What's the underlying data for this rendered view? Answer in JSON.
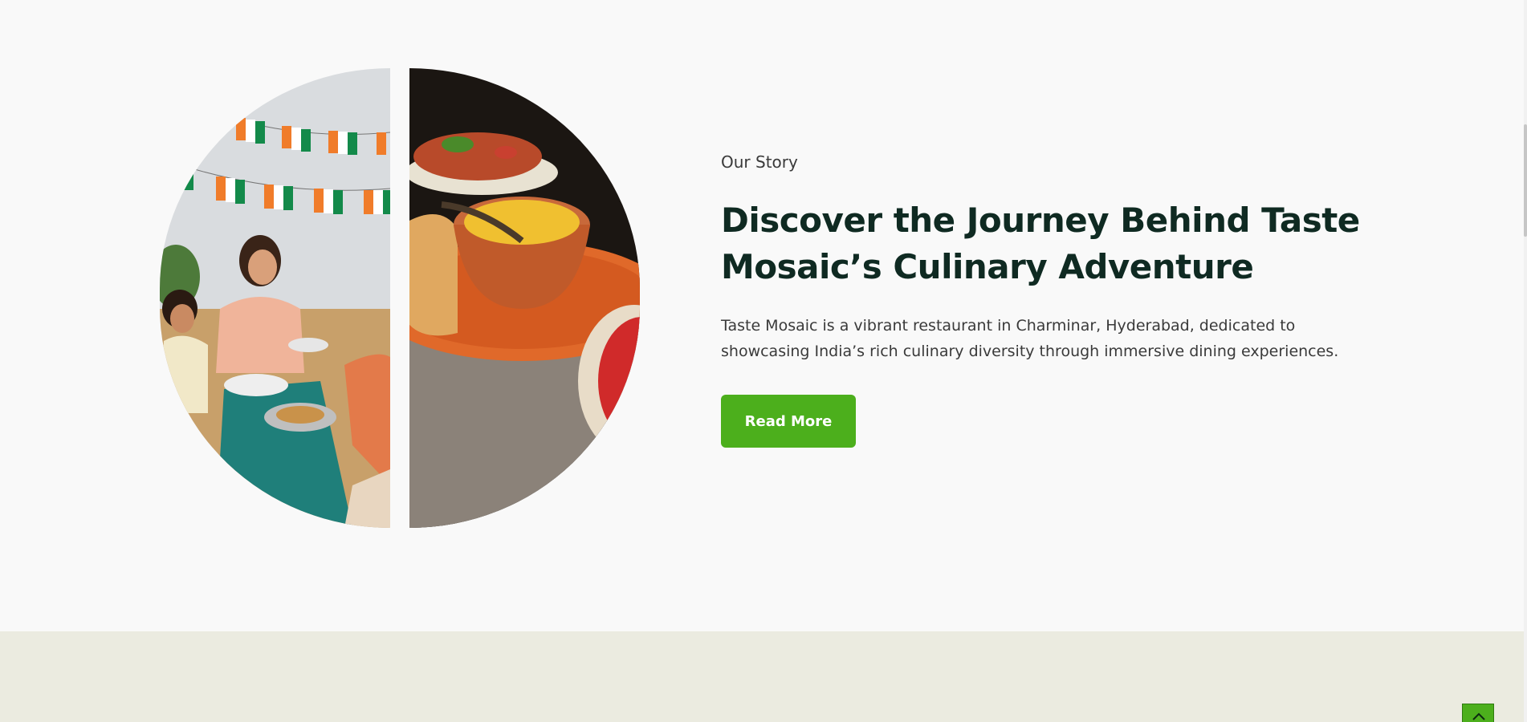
{
  "story": {
    "eyebrow": "Our Story",
    "headline": "Discover the Journey Behind Taste Mosaic’s Culinary Adventure",
    "description": "Taste Mosaic is a vibrant restaurant in Charminar, Hyderabad, dedicated to showcasing India’s rich culinary diversity through immersive dining experiences.",
    "button_label": "Read More"
  },
  "images": {
    "left": "family-dining-photo",
    "right": "indian-dishes-photo"
  },
  "icons": {
    "back_to_top": "chevron-up-icon"
  },
  "colors": {
    "accent": "#4caf1c",
    "headline": "#0f2a22",
    "page_bg": "#f9f9f9",
    "next_section_bg": "#ebebe0"
  }
}
